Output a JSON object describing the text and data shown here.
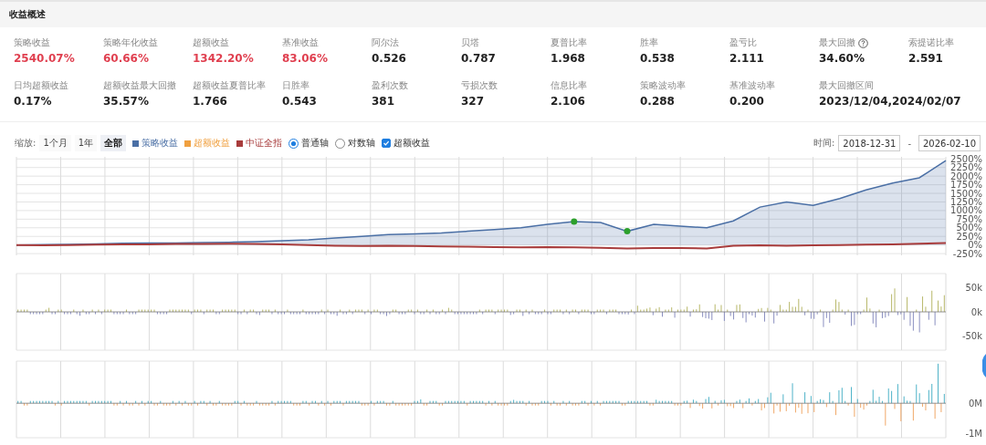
{
  "section": {
    "title": "收益概述"
  },
  "metrics": [
    [
      {
        "label": "策略收益",
        "value": "2540.07%",
        "highlight": true
      },
      {
        "label": "策略年化收益",
        "value": "60.66%",
        "highlight": true
      },
      {
        "label": "超额收益",
        "value": "1342.20%",
        "highlight": true
      },
      {
        "label": "基准收益",
        "value": "83.06%",
        "highlight": true
      },
      {
        "label": "阿尔法",
        "value": "0.526",
        "highlight": false
      },
      {
        "label": "贝塔",
        "value": "0.787",
        "highlight": false
      },
      {
        "label": "夏普比率",
        "value": "1.968",
        "highlight": false
      },
      {
        "label": "胜率",
        "value": "0.538",
        "highlight": false
      },
      {
        "label": "盈亏比",
        "value": "2.111",
        "highlight": false
      },
      {
        "label": "最大回撤",
        "value": "34.60%",
        "highlight": false,
        "help": true
      },
      {
        "label": "索提诺比率",
        "value": "2.591",
        "highlight": false
      }
    ],
    [
      {
        "label": "日均超额收益",
        "value": "0.17%",
        "highlight": false
      },
      {
        "label": "超额收益最大回撤",
        "value": "35.57%",
        "highlight": false
      },
      {
        "label": "超额收益夏普比率",
        "value": "1.766",
        "highlight": false
      },
      {
        "label": "日胜率",
        "value": "0.543",
        "highlight": false
      },
      {
        "label": "盈利次数",
        "value": "381",
        "highlight": false
      },
      {
        "label": "亏损次数",
        "value": "327",
        "highlight": false
      },
      {
        "label": "信息比率",
        "value": "2.106",
        "highlight": false
      },
      {
        "label": "策略波动率",
        "value": "0.288",
        "highlight": false
      },
      {
        "label": "基准波动率",
        "value": "0.200",
        "highlight": false
      },
      {
        "label": "最大回撤区间",
        "value": "2023/12/04,2024/02/07",
        "highlight": false
      }
    ]
  ],
  "toolbar": {
    "zoom_label": "缩放:",
    "zoom_options": [
      {
        "label": "1个月",
        "selected": false
      },
      {
        "label": "1年",
        "selected": false
      },
      {
        "label": "全部",
        "selected": true
      }
    ],
    "excess_legend": {
      "label": "超额收益",
      "color": "#f0a040"
    },
    "axis_modes": [
      {
        "label": "普通轴",
        "selected": true
      },
      {
        "label": "对数轴",
        "selected": false
      }
    ],
    "excess_toggle": {
      "label": "超额收益",
      "checked": true
    },
    "time_label": "时间:",
    "start_date": "2018-12-31",
    "separator": "-",
    "end_date": "2026-02-10"
  },
  "main_chart": {
    "chart_data": {
      "type": "area",
      "grid": true,
      "ylim": [
        -300,
        2560
      ],
      "yticks": [
        {
          "value": 2500,
          "label": "2500%"
        },
        {
          "value": 2250,
          "label": "2250%"
        },
        {
          "value": 2000,
          "label": "2000%"
        },
        {
          "value": 1750,
          "label": "1750%"
        },
        {
          "value": 1500,
          "label": "1500%"
        },
        {
          "value": 1250,
          "label": "1250%"
        },
        {
          "value": 1000,
          "label": "1000%"
        },
        {
          "value": 750,
          "label": "750%"
        },
        {
          "value": 500,
          "label": "500%"
        },
        {
          "value": 250,
          "label": "250%"
        },
        {
          "value": 0,
          "label": "0%"
        },
        {
          "value": -250,
          "label": "-250%"
        }
      ],
      "series": [
        {
          "name": "策略收益",
          "type": "area",
          "color": "#4a6fa5",
          "values": [
            0,
            10,
            20,
            30,
            50,
            60,
            60,
            70,
            80,
            100,
            120,
            150,
            200,
            250,
            300,
            320,
            350,
            400,
            450,
            500,
            600,
            680,
            650,
            400,
            600,
            550,
            500,
            700,
            1100,
            1250,
            1150,
            1350,
            1600,
            1800,
            1950,
            2450
          ]
        },
        {
          "name": "中证全指",
          "type": "line",
          "color": "#a83c3c",
          "values": [
            0,
            -10,
            0,
            10,
            20,
            20,
            30,
            30,
            40,
            30,
            20,
            0,
            -20,
            -30,
            -20,
            -30,
            -40,
            -50,
            -60,
            -70,
            -60,
            -70,
            -80,
            -100,
            -90,
            -90,
            -100,
            -20,
            -10,
            -20,
            -10,
            0,
            10,
            20,
            40,
            60
          ]
        }
      ]
    }
  },
  "excess_chart": {
    "tick_labels": [
      "50k",
      "0k",
      "-50k"
    ]
  },
  "volume_chart": {
    "tick_labels": [
      "0M",
      "-1M"
    ]
  }
}
